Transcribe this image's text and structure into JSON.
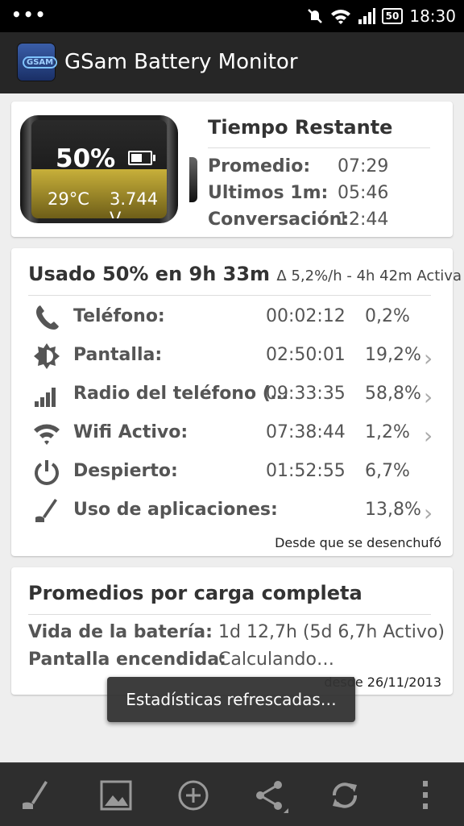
{
  "statusbar": {
    "time": "18:30",
    "battery": "50"
  },
  "appbar": {
    "title": "GSam Battery Monitor",
    "logo_text": "GSAM"
  },
  "battery_card": {
    "percent": "50%",
    "temperature": "29°C",
    "voltage": "3.744 V",
    "level": 0.5,
    "title": "Tiempo Restante",
    "rows": [
      {
        "label": "Promedio:",
        "value": "07:29"
      },
      {
        "label": "Ultimos 1m:",
        "value": "05:46"
      },
      {
        "label": "Conversación:",
        "value": "12:44"
      }
    ]
  },
  "usage_card": {
    "title": "Usado 50% en 9h 33m",
    "subtitle": "Δ 5,2%/h - 4h 42m Activa",
    "rows": [
      {
        "icon": "phone-icon",
        "label": "Teléfono:",
        "time": "00:02:12",
        "percent": "0,2%",
        "chevron": false
      },
      {
        "icon": "brightness-icon",
        "label": "Pantalla:",
        "time": "02:50:01",
        "percent": "19,2%",
        "chevron": true
      },
      {
        "icon": "signal-icon",
        "label": "Radio del teléfono (…",
        "time": "09:33:35",
        "percent": "58,8%",
        "chevron": true
      },
      {
        "icon": "wifi-icon",
        "label": "Wifi Activo:",
        "time": "07:38:44",
        "percent": "1,2%",
        "chevron": true
      },
      {
        "icon": "power-icon",
        "label": "Despierto:",
        "time": "01:52:55",
        "percent": "6,7%",
        "chevron": false
      },
      {
        "icon": "app-usage-icon",
        "label": "Uso de aplicaciones:",
        "time": "",
        "percent": "13,8%",
        "chevron": true
      }
    ],
    "since": "Desde que se desenchufó"
  },
  "averages_card": {
    "title": "Promedios por carga completa",
    "rows": [
      {
        "label": "Vida de la batería:",
        "value": "1d 12,7h (5d 6,7h Activo)"
      },
      {
        "label": "Pantalla encendida:",
        "value": "Calculando…"
      }
    ],
    "since": "desde 26/11/2013"
  },
  "toast": {
    "text": "Estadísticas refrescadas…"
  },
  "bottombar": {
    "icons": [
      "app-usage-icon",
      "image-icon",
      "add-icon",
      "share-icon",
      "refresh-icon",
      "overflow-menu-icon"
    ]
  }
}
